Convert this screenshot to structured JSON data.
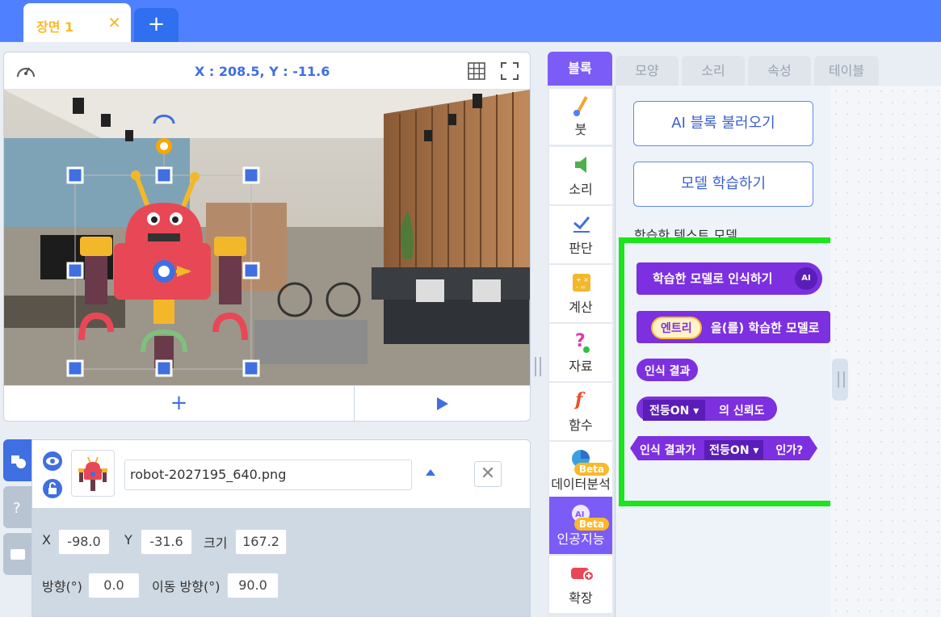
{
  "scene": {
    "tab_label": "장면 1",
    "close_glyph": "✕",
    "add_glyph": "+"
  },
  "stage": {
    "coords": "X : 208.5, Y : -11.6",
    "add_glyph": "+"
  },
  "object": {
    "filename": "robot-2027195_640.png",
    "close_glyph": "✕",
    "props": {
      "x_label": "X",
      "x_value": "-98.0",
      "y_label": "Y",
      "y_value": "-31.6",
      "size_label": "크기",
      "size_value": "167.2",
      "dir_label": "방향(°)",
      "dir_value": "0.0",
      "move_label": "이동 방향(°)",
      "move_value": "90.0"
    }
  },
  "tabs": [
    {
      "label": "블록",
      "active": true
    },
    {
      "label": "모양"
    },
    {
      "label": "소리"
    },
    {
      "label": "속성"
    },
    {
      "label": "테이블"
    }
  ],
  "categories": [
    {
      "label": "붓",
      "icon": "brush-icon"
    },
    {
      "label": "소리",
      "icon": "speaker-icon"
    },
    {
      "label": "판단",
      "icon": "check-icon"
    },
    {
      "label": "계산",
      "icon": "calculator-icon"
    },
    {
      "label": "자료",
      "icon": "question-icon"
    },
    {
      "label": "함수",
      "icon": "function-icon"
    },
    {
      "label": "데이터분석",
      "icon": "pie-chart-icon",
      "badge": "Beta"
    },
    {
      "label": "인공지능",
      "icon": "ai-icon",
      "badge": "Beta"
    },
    {
      "label": "확장",
      "icon": "extension-icon"
    }
  ],
  "palette": {
    "load_ai_button": "AI 블록 불러오기",
    "train_model_button": "모델 학습하기",
    "section_label": "학습한 텍스트 모델",
    "blocks": {
      "recognize": "학습한 모델로 인식하기",
      "ai_badge": "AI",
      "entry_pill": "엔트리",
      "entry_suffix": "을(를) 학습한 모델로",
      "result": "인식 결과",
      "light_dropdown": "전등ON ▾",
      "confidence_suffix": "의 신뢰도",
      "result_is_prefix": "인식 결과가",
      "result_is_dropdown": "전등ON ▾",
      "result_is_suffix": "인가?"
    }
  },
  "colors": {
    "accent": "#7c5cf6",
    "block": "#7c30e0",
    "highlight": "#1be51b",
    "topbar": "#4f80ff"
  }
}
